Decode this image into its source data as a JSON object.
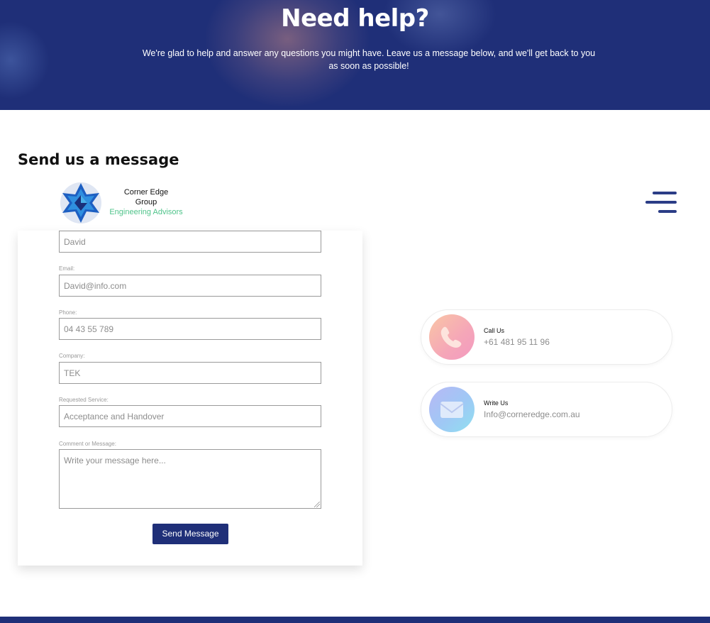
{
  "hero": {
    "title": "Need help?",
    "subtitle": "We're glad to help and answer any questions you might have. Leave us a message below, and we'll get back to you as soon as possible!"
  },
  "section": {
    "title": "Send us a message"
  },
  "logo": {
    "line1": "Corner Edge",
    "line2": "Group",
    "line3": "Engineering Advisors"
  },
  "form": {
    "fields": [
      {
        "label": "",
        "value": "David"
      },
      {
        "label": "Email:",
        "value": "David@info.com"
      },
      {
        "label": "Phone:",
        "value": "04 43 55 789"
      },
      {
        "label": "Company:",
        "value": "TEK"
      },
      {
        "label": "Requested Service:",
        "value": "Acceptance and Handover"
      }
    ],
    "message": {
      "label": "Comment or Message:",
      "placeholder": "Write your message here..."
    },
    "submit_label": "Send Message"
  },
  "contacts": [
    {
      "title": "Call Us",
      "value": "+61 481 95 11 96",
      "icon": "phone-icon"
    },
    {
      "title": "Write Us",
      "value": "Info@corneredge.com.au",
      "icon": "envelope-icon"
    }
  ],
  "colors": {
    "brand_navy": "#1f2f78",
    "accent_green": "#4fc38a",
    "hamburger": "#2b3d86"
  }
}
